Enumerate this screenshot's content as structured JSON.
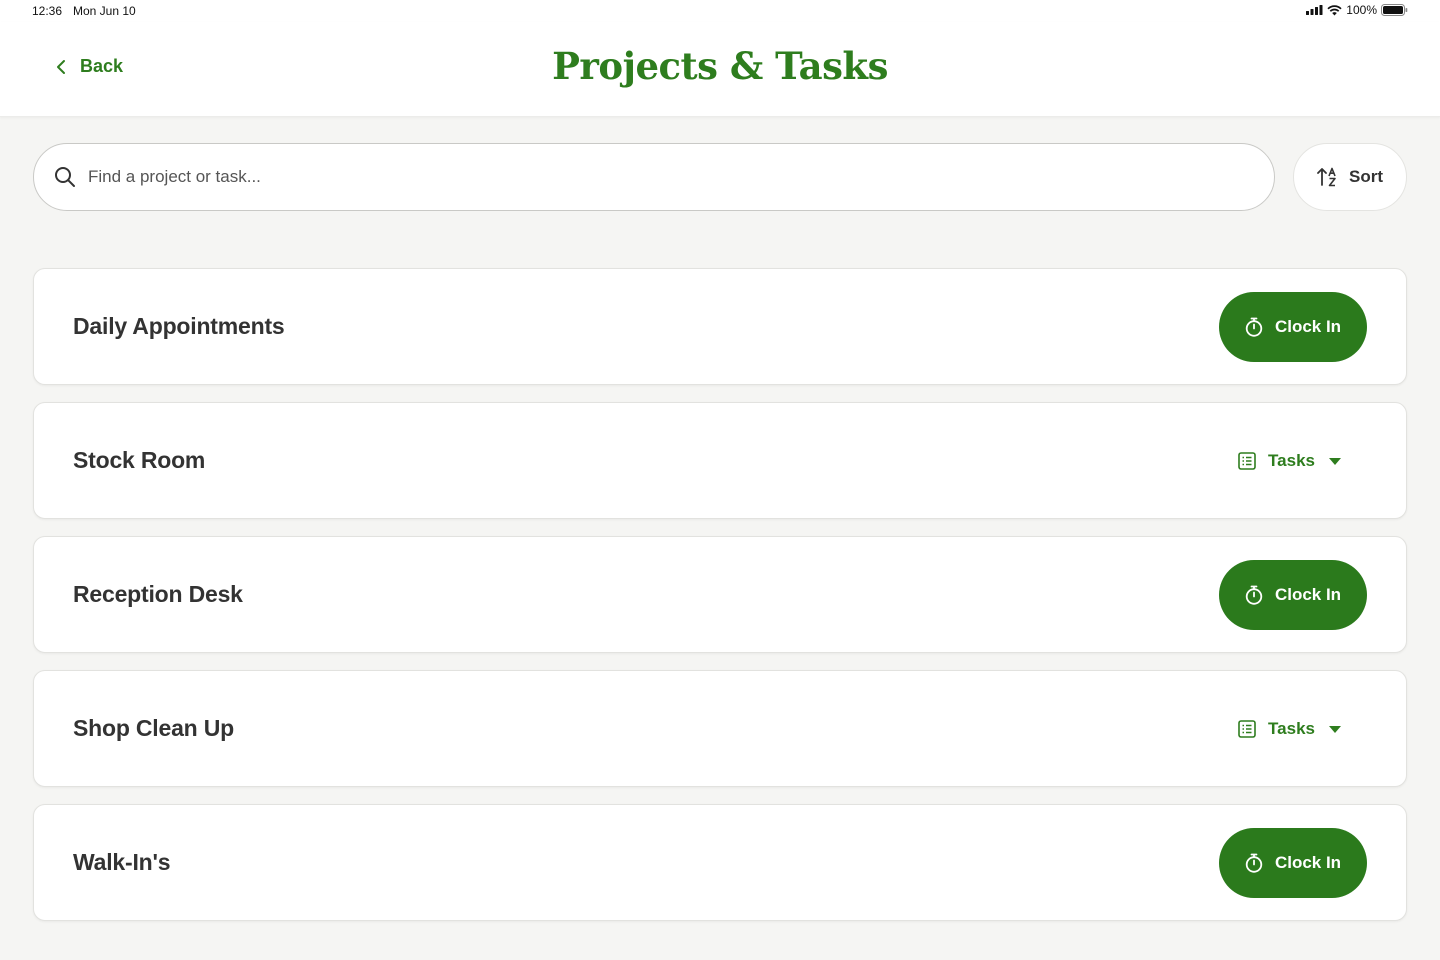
{
  "status_bar": {
    "time": "12:36",
    "date": "Mon Jun 10",
    "battery": "100%"
  },
  "header": {
    "back_label": "Back",
    "title": "Projects & Tasks"
  },
  "search": {
    "placeholder": "Find a project or task..."
  },
  "sort": {
    "label": "Sort"
  },
  "projects": [
    {
      "name": "Daily Appointments",
      "action": "clock_in",
      "action_label": "Clock In"
    },
    {
      "name": "Stock Room",
      "action": "tasks",
      "action_label": "Tasks"
    },
    {
      "name": "Reception Desk",
      "action": "clock_in",
      "action_label": "Clock In"
    },
    {
      "name": "Shop Clean Up",
      "action": "tasks",
      "action_label": "Tasks"
    },
    {
      "name": "Walk-In's",
      "action": "clock_in",
      "action_label": "Clock In"
    }
  ],
  "colors": {
    "brand_green": "#2e7d1e",
    "button_green": "#2b7a1c",
    "background": "#f5f5f3"
  }
}
